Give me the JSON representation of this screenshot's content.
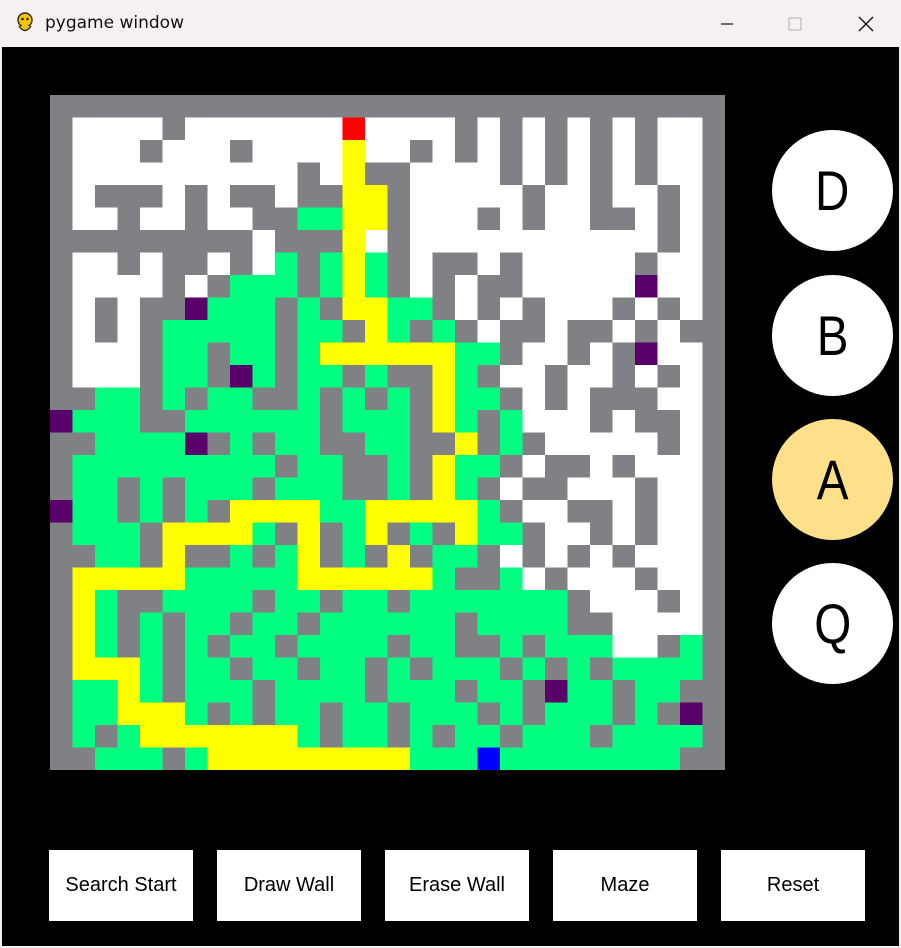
{
  "window": {
    "title": "pygame window"
  },
  "titlebar_buttons": {
    "minimize": "minimize-icon",
    "maximize": "maximize-icon",
    "close": "close-icon"
  },
  "maze": {
    "cols": 30,
    "rows": 30,
    "colors": {
      "wall": "#808184",
      "open": "#ffffff",
      "visited": "#00ff80",
      "path": "#ffff00",
      "start": "#ff0000",
      "end": "#0000ff",
      "frontier": "#5a006a"
    },
    "grid": [
      "##############################",
      "#WWWW#WWWWWWWSWWWW#W#W#W#W#WW#",
      "#WWW#WWW#WWWWPWW#W#W#W#W#W#WW#",
      "#WWWWWWWWWW#WPYYWWWW#W#W#W#WW#",
      "#W###W#W##W##PPYWWWWW#WW#WW#W#",
      "#WW#WW#WW##GGPPYWWW#W#WW##W#W#",
      "#########W###PW#WWWWWWWWWWW#W#",
      "#WW#W##W#WG#GPG#W##W#WWWWW#WW#",
      "#WWWW#W#GGG#GPG#W#W##WWWWWFWW#",
      "#W#W##FGGG#G#PPGG#W#W#WWW#W#W#",
      "#W#W#GGGGG#GG#PG#G#W##W##W#W##",
      "#WWW#GG#GG#GPPPPPPGG#WW#W#FWW#",
      "#WWW#GG#FG#GG#G##PG#WW#WW#W#W#",
      "##GG#G#GG##G#G#G#PGG#W#W###WW#",
      "FGGG##GGGGGG#GGG#PG#GWWW#W##W#",
      "##GGGGF#G#GG##GG##P#G#WWWWW#W#",
      "#GGGGGGGGG#GG##G#PGG#W##W#WWW#",
      "#GG#G#GGG#GGG##G#PG#W##WWW#WW#",
      "FGG#G#G#PPPPGGPPPPPG#WW##W#WW#",
      "#GGG#PPPPG#P#GP#G#PGG#WW#W#WW#",
      "##GG#P##G#GP#G#P#GG#W#W#W#WWW#",
      "#PPPPPGGGGGPPPPPPG##GW#WWW#WW#",
      "#PG##GGGG#GG#GG#GGGGGGG#WWW#W#",
      "#PG#G#GG#GG#GGGGGG#GGGG##WWWW#",
      "#PG#G#G#GG#GGGG#GG##G#GGGWW#G#",
      "#PPPG#GG#GG#GG#G#GGG#G#G#GGGG#",
      "#GGPG#GGG#GGGG#GGG#GG#FGG#GG##",
      "#GGPPPG#G#GG#GG#GGG#G#GGG#G#F#",
      "#G#GPPPPPPPG#GG#G#GG#GGG#GGGG#",
      "##GGG#GPPPPPPPPPGGGEGGGGGGGG##"
    ]
  },
  "algorithms": [
    {
      "label": "D",
      "active": false
    },
    {
      "label": "B",
      "active": false
    },
    {
      "label": "A",
      "active": true
    },
    {
      "label": "Q",
      "active": false
    }
  ],
  "controls": {
    "search_start": "Search Start",
    "draw_wall": "Draw Wall",
    "erase_wall": "Erase Wall",
    "maze": "Maze",
    "reset": "Reset"
  }
}
